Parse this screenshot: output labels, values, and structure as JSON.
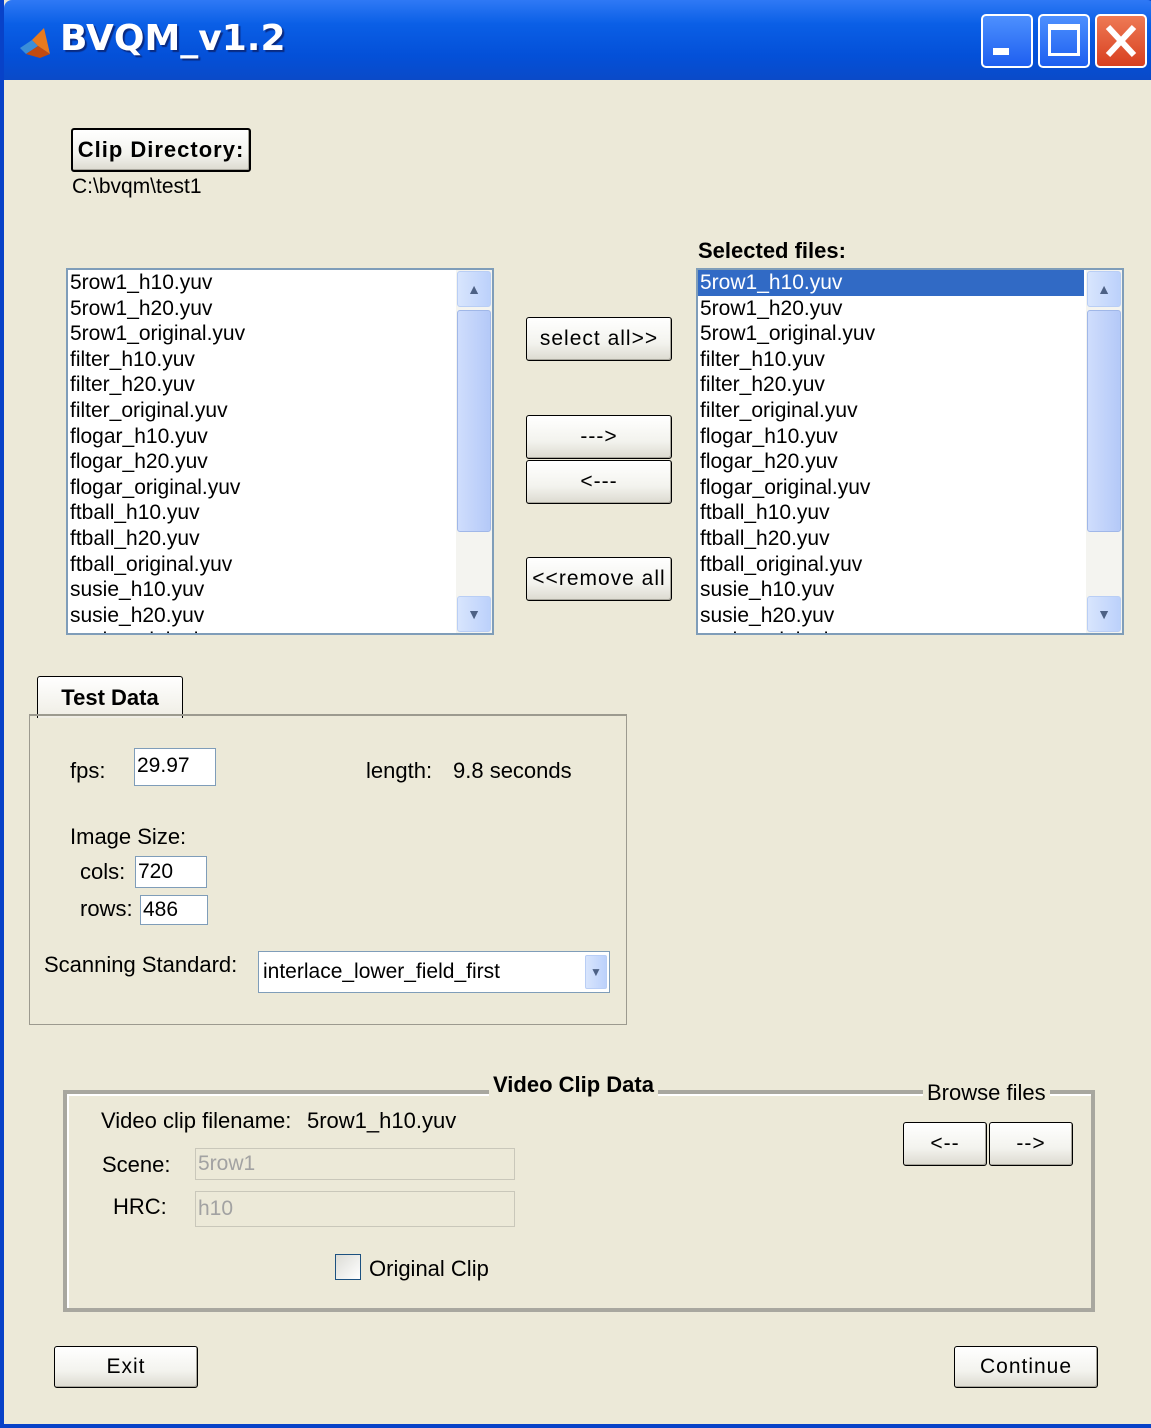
{
  "window": {
    "title": "BVQM_v1.2",
    "icon": "matlab-logo-icon"
  },
  "clip_directory": {
    "button_label": "Clip Directory:",
    "path": "C:\\bvqm\\test1"
  },
  "available_files": {
    "items": [
      "5row1_h10.yuv",
      "5row1_h20.yuv",
      "5row1_original.yuv",
      "filter_h10.yuv",
      "filter_h20.yuv",
      "filter_original.yuv",
      "flogar_h10.yuv",
      "flogar_h20.yuv",
      "flogar_original.yuv",
      "ftball_h10.yuv",
      "ftball_h20.yuv",
      "ftball_original.yuv",
      "susie_h10.yuv",
      "susie_h20.yuv",
      "susie_original.yuv"
    ]
  },
  "selected_files": {
    "label": "Selected files:",
    "items": [
      "5row1_h10.yuv",
      "5row1_h20.yuv",
      "5row1_original.yuv",
      "filter_h10.yuv",
      "filter_h20.yuv",
      "filter_original.yuv",
      "flogar_h10.yuv",
      "flogar_h20.yuv",
      "flogar_original.yuv",
      "ftball_h10.yuv",
      "ftball_h20.yuv",
      "ftball_original.yuv",
      "susie_h10.yuv",
      "susie_h20.yuv",
      "susie_original.yuv"
    ],
    "selected": "5row1_h10.yuv"
  },
  "transfer": {
    "select_all": "select all>>",
    "add": "--->",
    "remove": "<---",
    "remove_all": "<<remove all"
  },
  "test_data": {
    "tab_label": "Test Data",
    "fps_label": "fps:",
    "fps_value": "29.97",
    "length_label": "length:",
    "length_value": "9.8 seconds",
    "image_size_label": "Image Size:",
    "cols_label": "cols:",
    "cols_value": "720",
    "rows_label": "rows:",
    "rows_value": "486",
    "scanning_label": "Scanning Standard:",
    "scanning_value": "interlace_lower_field_first"
  },
  "video_clip_data": {
    "title": "Video Clip Data",
    "filename_label": "Video clip filename:",
    "filename_value": "5row1_h10.yuv",
    "scene_label": "Scene:",
    "scene_value": "5row1",
    "hrc_label": "HRC:",
    "hrc_value": "h10",
    "original_clip_label": "Original Clip",
    "original_clip_checked": false,
    "browse_label": "Browse files",
    "browse_prev": "<--",
    "browse_next": "-->"
  },
  "footer": {
    "exit": "Exit",
    "continue": "Continue"
  }
}
